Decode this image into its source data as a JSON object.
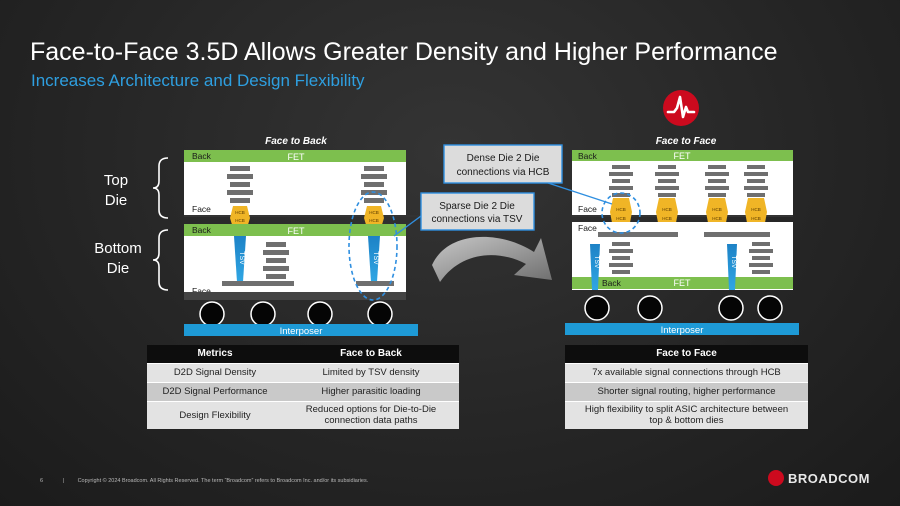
{
  "slide": {
    "title": "Face-to-Face 3.5D Allows Greater Density and Higher Performance",
    "subtitle": "Increases Architecture and Design Flexibility"
  },
  "diagram": {
    "face_to_back": {
      "heading": "Face to Back",
      "top_back_label": "Back",
      "top_fet_label": "FET",
      "top_face_label": "Face",
      "bottom_back_label": "Back",
      "bottom_fet_label": "FET",
      "bottom_face_label": "Face",
      "tsv_label": "TSV",
      "hcb_label": "HCB",
      "interposer_label": "Interposer"
    },
    "face_to_face": {
      "heading": "Face to Face",
      "top_back_label": "Back",
      "top_fet_label": "FET",
      "face_label_upper": "Face",
      "face_label_lower": "Face",
      "bottom_back_label": "Back",
      "bottom_fet_label": "FET",
      "tsv_label": "TSV",
      "hcb_label": "HCB",
      "interposer_label": "Interposer"
    },
    "top_die_label": "Top Die",
    "top_die_line1": "Top",
    "top_die_line2": "Die",
    "bottom_die_line1": "Bottom",
    "bottom_die_line2": "Die",
    "callout_dense_line1": "Dense Die 2 Die",
    "callout_dense_line2": "connections via HCB",
    "callout_sparse_line1": "Sparse Die 2 Die",
    "callout_sparse_line2": "connections via TSV",
    "colors": {
      "fet_green": "#7dbf4e",
      "tsv_blue": "#1e86c8",
      "interposer_blue": "#1e9ad6",
      "hcb_yellow": "#f0b526",
      "metal_gray": "#6f6f6f",
      "accent_red": "#cc0a1e",
      "dashed_blue": "#2f8fe0"
    }
  },
  "table_left": {
    "header_metrics": "Metrics",
    "header_value": "Face to Back",
    "rows": [
      {
        "metric": "D2D Signal Density",
        "value": "Limited by TSV density"
      },
      {
        "metric": "D2D Signal Performance",
        "value": "Higher parasitic loading"
      },
      {
        "metric": "Design Flexibility",
        "value_line1": "Reduced options for Die-to-Die",
        "value_line2": "connection data paths"
      }
    ]
  },
  "table_right": {
    "header": "Face to Face",
    "rows": [
      {
        "value": "7x available signal connections through HCB"
      },
      {
        "value": "Shorter signal routing, higher performance"
      },
      {
        "value_line1": "High flexibility to split ASIC architecture between",
        "value_line2": "top & bottom dies"
      }
    ]
  },
  "footer": {
    "page_number": "6",
    "separator": "|",
    "copyright": "Copyright © 2024 Broadcom.  All Rights Reserved. The term “Broadcom” refers to Broadcom Inc. and/or its subsidiaries.",
    "brand": "BROADCOM"
  }
}
